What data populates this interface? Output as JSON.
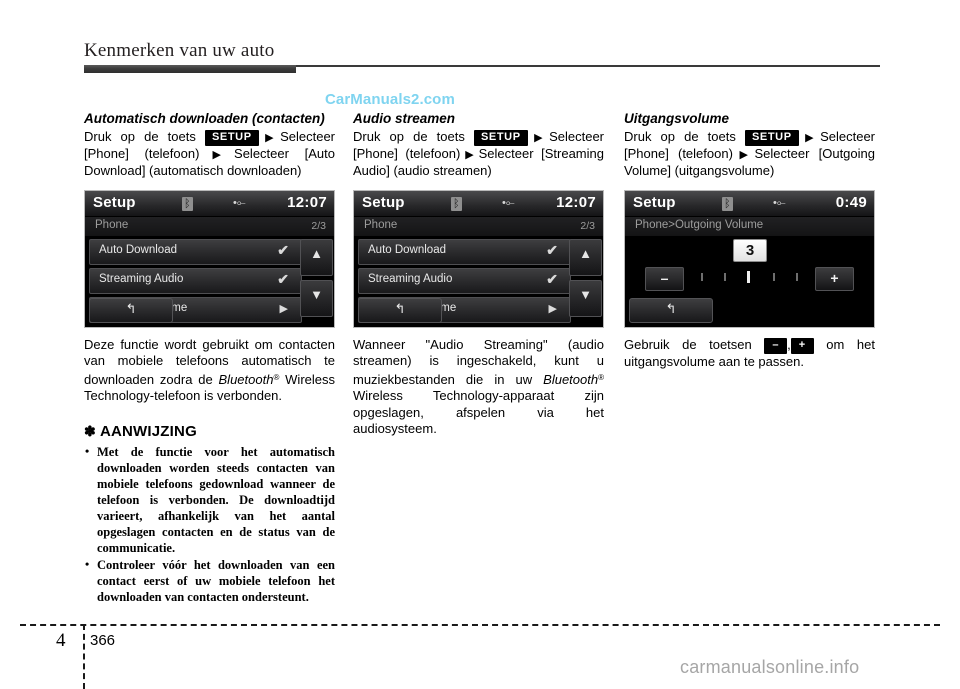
{
  "header": {
    "title": "Kenmerken van uw auto"
  },
  "watermarks": {
    "top": "CarManuals2.com",
    "bottom": "carmanualsonline.info"
  },
  "footer": {
    "chapter": "4",
    "page": "366"
  },
  "columns": [
    {
      "id": "auto-download",
      "title": "Automatisch downloaden (contacten)",
      "instruction_parts": {
        "lead": "Druk op de toets",
        "chip": "SETUP",
        "after_chip": "Selecteer [Phone] (telefoon)",
        "after_arrow2": "Selecteer [Auto Download] (automatisch downloaden)"
      },
      "description": {
        "pre": "Deze functie wordt gebruikt om contacten van mobiele telefoons automatisch te downloaden zodra de",
        "brand": "Bluetooth",
        "post": " Wireless Technology-telefoon is verbonden."
      },
      "notice": {
        "star": "✽",
        "heading": "AANWIJZING",
        "items": [
          "Met de functie voor het automatisch downloaden worden steeds contacten van mobiele telefoons gedownload wanneer de telefoon is verbonden. De downloadtijd varieert, afhankelijk van het aantal opgeslagen contacten en de status van de communicatie.",
          "Controleer vóór het downloaden van een contact eerst of uw mobiele telefoon het downloaden van contacten ondersteunt."
        ]
      },
      "screen": {
        "type": "list",
        "title": "Setup",
        "bluetooth_icon": "bluetooth-icon",
        "usb_icon": "usb-icon",
        "clock": "12:07",
        "subtitle": "Phone",
        "pageno": "2/3",
        "rows": [
          {
            "label": "Auto Download",
            "indicator": "check"
          },
          {
            "label": "Streaming Audio",
            "indicator": "check"
          },
          {
            "label": "Outgoing Volume",
            "indicator": "caret"
          }
        ],
        "scroll_up": "▲",
        "scroll_down": "▼",
        "back": "↰"
      }
    },
    {
      "id": "audio-streaming",
      "title": "Audio streamen",
      "instruction_parts": {
        "lead": "Druk op de toets",
        "chip": "SETUP",
        "after_chip": "Selecteer [Phone] (telefoon)",
        "after_arrow2": "Selecteer [Streaming Audio] (audio streamen)"
      },
      "description": {
        "pre": "Wanneer \"Audio Streaming\" (audio streamen) is ingeschakeld, kunt u muziekbestanden die in uw",
        "brand": "Bluetooth",
        "post": " Wireless Technology-apparaat zijn opgeslagen, afspelen via het audiosysteem."
      },
      "screen": {
        "type": "list",
        "title": "Setup",
        "bluetooth_icon": "bluetooth-icon",
        "usb_icon": "usb-icon",
        "clock": "12:07",
        "subtitle": "Phone",
        "pageno": "2/3",
        "rows": [
          {
            "label": "Auto Download",
            "indicator": "check"
          },
          {
            "label": "Streaming Audio",
            "indicator": "check"
          },
          {
            "label": "Outgoing Volume",
            "indicator": "caret"
          }
        ],
        "scroll_up": "▲",
        "scroll_down": "▼",
        "back": "↰"
      }
    },
    {
      "id": "outgoing-volume",
      "title": "Uitgangsvolume",
      "instruction_parts": {
        "lead": "Druk op de toets",
        "chip": "SETUP",
        "after_chip": "Selecteer [Phone] (telefoon)",
        "after_arrow2": "Selecteer [Outgoing Volume] (uitgangsvolume)"
      },
      "description": {
        "lead": "Gebruik de toetsen",
        "minus_chip": "–",
        "comma": ",",
        "plus_chip": "+",
        "tail": "om het uitgangsvolume aan te passen."
      },
      "screen": {
        "type": "volume",
        "title": "Setup",
        "bluetooth_icon": "bluetooth-icon",
        "usb_icon": "usb-icon",
        "clock": "0:49",
        "subtitle": "Phone>Outgoing Volume",
        "value": "3",
        "minus": "–",
        "plus": "+",
        "back": "↰"
      }
    }
  ]
}
